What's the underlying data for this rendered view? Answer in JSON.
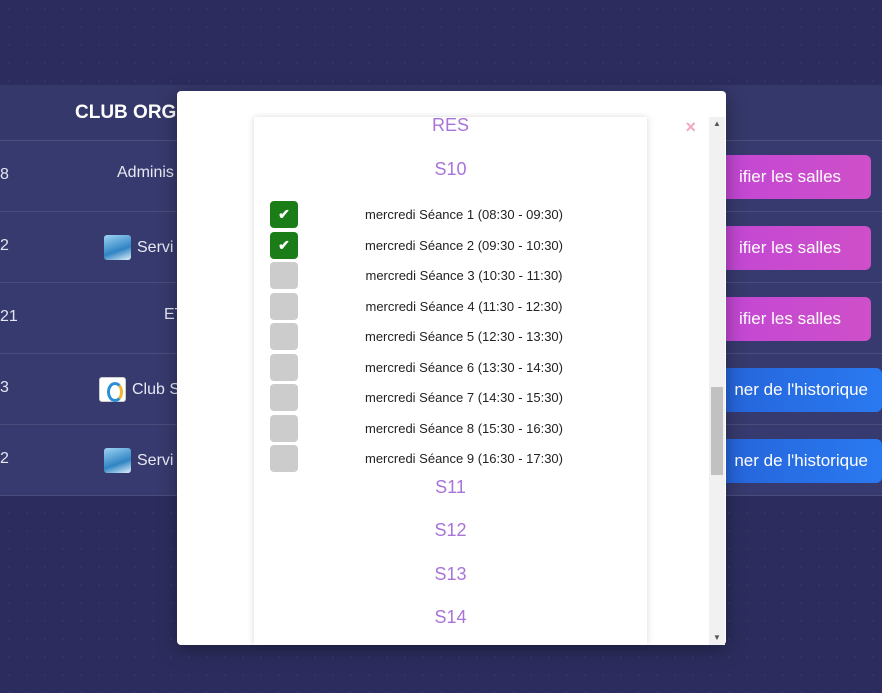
{
  "table": {
    "header": "CLUB ORGA",
    "rows": [
      {
        "num": "8",
        "club": "Adminis",
        "logo": "none",
        "action": "ifier les salles",
        "style": "pink"
      },
      {
        "num": "2",
        "club": "Servi",
        "logo": "water",
        "action": "ifier les salles",
        "style": "pink"
      },
      {
        "num": "21",
        "club": "ET",
        "logo": "none",
        "action": "ifier les salles",
        "style": "pink"
      },
      {
        "num": "3",
        "club": "Club S",
        "logo": "swim",
        "action": "ner de l'historique",
        "style": "blue"
      },
      {
        "num": "2",
        "club": "Servi",
        "logo": "water",
        "action": "ner de l'historique",
        "style": "blue"
      }
    ]
  },
  "modal": {
    "close_symbol": "×",
    "weeks_before": [
      "RES",
      "S10"
    ],
    "seances": [
      {
        "label": "mercredi Séance 1 (08:30 - 09:30)",
        "checked": true
      },
      {
        "label": "mercredi Séance 2 (09:30 - 10:30)",
        "checked": true
      },
      {
        "label": "mercredi Séance 3 (10:30 - 11:30)",
        "checked": false
      },
      {
        "label": "mercredi Séance 4 (11:30 - 12:30)",
        "checked": false
      },
      {
        "label": "mercredi Séance 5 (12:30 - 13:30)",
        "checked": false
      },
      {
        "label": "mercredi Séance 6 (13:30 - 14:30)",
        "checked": false
      },
      {
        "label": "mercredi Séance 7 (14:30 - 15:30)",
        "checked": false
      },
      {
        "label": "mercredi Séance 8 (15:30 - 16:30)",
        "checked": false
      },
      {
        "label": "mercredi Séance 9 (16:30 - 17:30)",
        "checked": false
      }
    ],
    "weeks_after": [
      "S11",
      "S12",
      "S13",
      "S14"
    ],
    "check_symbol": "✔"
  },
  "colors": {
    "background": "#2c2d5e",
    "checked": "#1b7d18",
    "week_label": "#a874d9",
    "pink_button": "#c146d6",
    "blue_button": "#2a79f0"
  }
}
